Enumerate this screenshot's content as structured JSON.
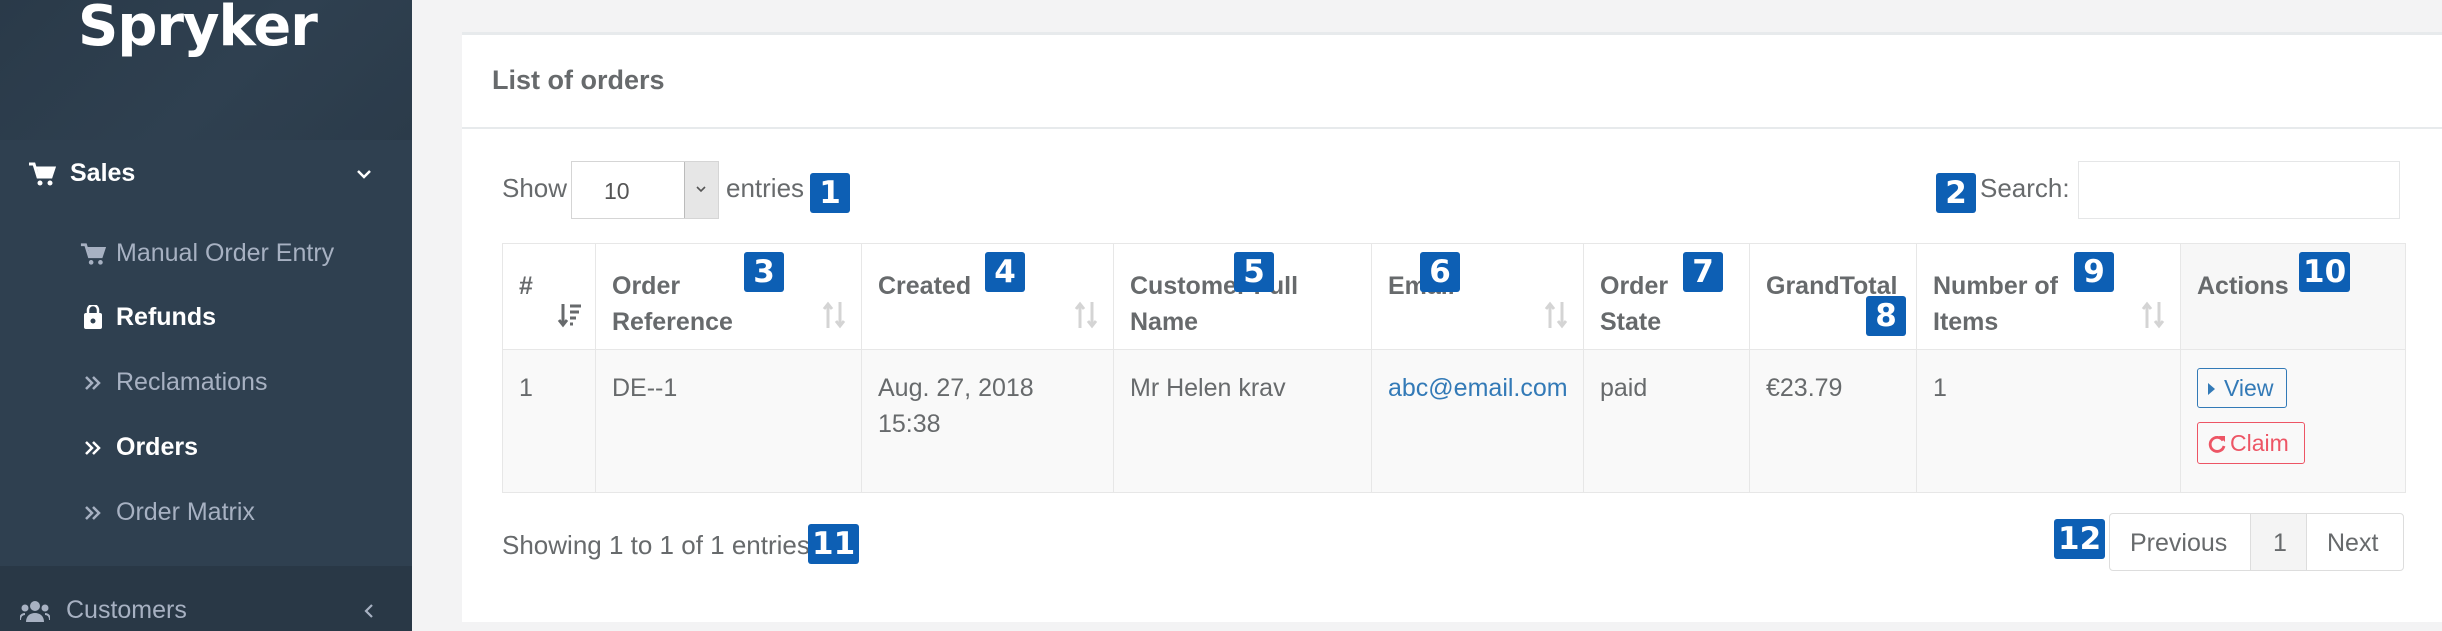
{
  "brand": "Spryker",
  "sidebar": {
    "sales_label": "Sales",
    "items": [
      {
        "label": "Manual Order Entry"
      },
      {
        "label": "Refunds"
      },
      {
        "label": "Reclamations"
      },
      {
        "label": "Orders"
      },
      {
        "label": "Order Matrix"
      }
    ],
    "customers_label": "Customers"
  },
  "panel": {
    "title": "List of orders",
    "show_label": "Show",
    "page_size": "10",
    "entries_label": "entries",
    "search_label": "Search:",
    "search_value": ""
  },
  "table": {
    "columns": [
      {
        "line1": "#",
        "line2": ""
      },
      {
        "line1": "Order",
        "line2": "Reference"
      },
      {
        "line1": "Created",
        "line2": ""
      },
      {
        "line1": "Customer Full",
        "line2": "Name"
      },
      {
        "line1": "Email",
        "line2": ""
      },
      {
        "line1": "Order",
        "line2": "State"
      },
      {
        "line1": "GrandTotal",
        "line2": ""
      },
      {
        "line1": "Number of",
        "line2": "Items"
      },
      {
        "line1": "Actions",
        "line2": ""
      }
    ],
    "row": {
      "num": "1",
      "reference": "DE--1",
      "created_date": "Aug. 27, 2018",
      "created_time": "15:38",
      "customer": "Mr Helen krav",
      "email": "abc@email.com",
      "state": "paid",
      "total": "€23.79",
      "items": "1",
      "view_label": "View",
      "claim_label": "Claim"
    }
  },
  "footer": {
    "info": "Showing 1 to 1 of 1 entries",
    "prev": "Previous",
    "page": "1",
    "next": "Next"
  },
  "badges": [
    "1",
    "2",
    "3",
    "4",
    "5",
    "6",
    "7",
    "8",
    "9",
    "10",
    "11",
    "12"
  ],
  "colors": {
    "sidebar": "#2f4050",
    "badge": "#0d5fb4",
    "link": "#337ab7",
    "danger": "#ed5565"
  }
}
